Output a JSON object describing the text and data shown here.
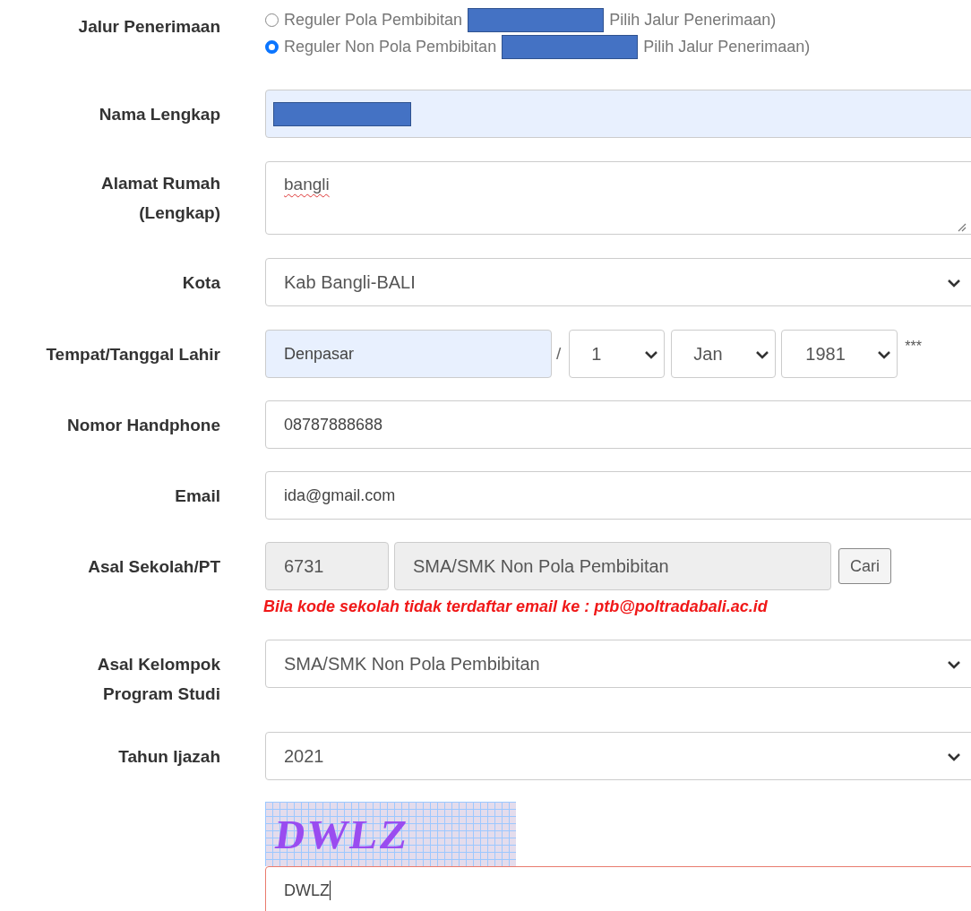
{
  "jalur": {
    "label": "Jalur Penerimaan",
    "options": [
      {
        "text": "Reguler Pola Pembibitan",
        "redacted": true,
        "note": "Pilih Jalur Penerimaan)",
        "selected": false
      },
      {
        "text": "Reguler Non Pola Pembibitan",
        "redacted": true,
        "note": "Pilih Jalur Penerimaan)",
        "selected": true
      }
    ]
  },
  "nama": {
    "label": "Nama Lengkap",
    "redacted": true
  },
  "alamat": {
    "label": "Alamat Rumah (Lengkap)",
    "value": "bangli"
  },
  "kota": {
    "label": "Kota",
    "value": "Kab Bangli-BALI"
  },
  "lahir": {
    "label": "Tempat/Tanggal Lahir",
    "place": "Denpasar",
    "separator": "/",
    "day": "1",
    "month": "Jan",
    "year": "1981",
    "mark": "***"
  },
  "hp": {
    "label": "Nomor Handphone",
    "value": "08787888688"
  },
  "email": {
    "label": "Email",
    "value": "ida@gmail.com"
  },
  "sekolah": {
    "label": "Asal Sekolah/PT",
    "code": "6731",
    "name": "SMA/SMK Non Pola Pembibitan",
    "button": "Cari",
    "warning": "Bila kode sekolah tidak terdaftar email ke : ptb@poltradabali.ac.id"
  },
  "kelompok": {
    "label": "Asal Kelompok Program Studi",
    "value": "SMA/SMK Non Pola Pembibitan"
  },
  "tahun": {
    "label": "Tahun Ijazah",
    "value": "2021"
  },
  "captcha": {
    "text": "DWLZ",
    "value": "DWLZ"
  }
}
